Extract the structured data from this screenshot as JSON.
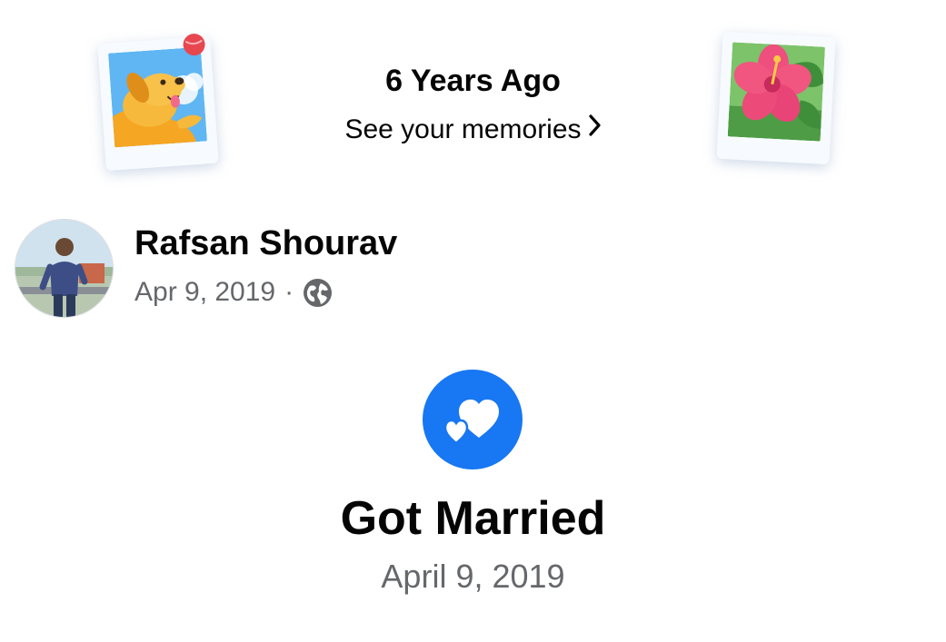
{
  "memories": {
    "title": "6 Years Ago",
    "link_label": "See your memories",
    "decorations": [
      "dog-polaroid-sticker",
      "hibiscus-polaroid-sticker"
    ]
  },
  "post": {
    "author_name": "Rafsan Shourav",
    "date": "Apr 9, 2019",
    "separator": "·",
    "privacy_icon": "globe-icon",
    "privacy": "Public"
  },
  "life_event": {
    "icon": "hearts-icon",
    "title": "Got Married",
    "date": "April 9, 2019"
  },
  "colors": {
    "accent": "#1877f2",
    "text_primary": "#050505",
    "text_secondary": "#65676b",
    "background": "#ffffff"
  }
}
